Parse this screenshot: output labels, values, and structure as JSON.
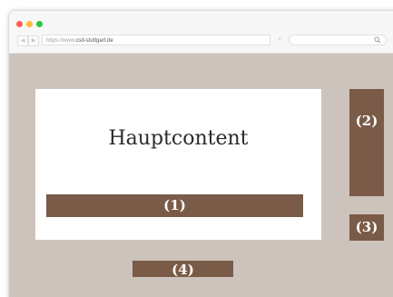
{
  "browser": {
    "url_prefix": "https://www.",
    "url_domain": "csd-stuttgart.de",
    "close_symbol": "×"
  },
  "page": {
    "main_title": "Hauptcontent",
    "block_1_label": "(1)",
    "block_2_label": "(2)",
    "block_3_label": "(3)",
    "block_4_label": "(4)"
  },
  "colors": {
    "page_background": "#cdc3bd",
    "block_brown": "#7a5b47",
    "content_white": "#ffffff"
  },
  "icons": {
    "traffic_lights": [
      "close-dot",
      "minimize-dot",
      "maximize-dot"
    ],
    "nav": [
      "back-arrow-icon",
      "forward-arrow-icon"
    ],
    "search": "search-icon"
  }
}
